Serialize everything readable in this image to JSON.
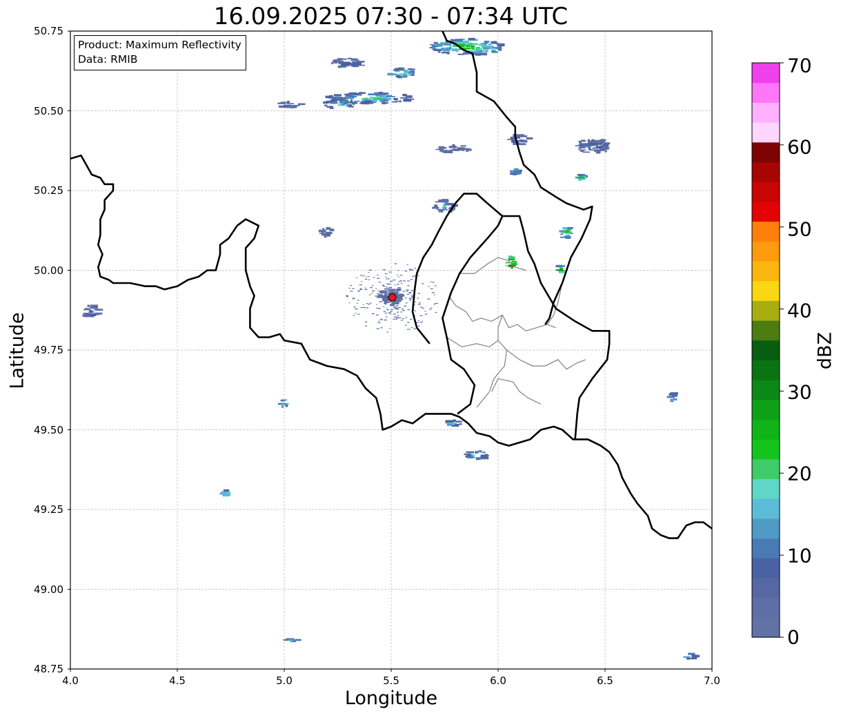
{
  "title": "16.09.2025 07:30 - 07:34 UTC",
  "info_box": {
    "product": "Product: Maximum Reflectivity",
    "data": "Data: RMIB"
  },
  "colorbar": {
    "label": "dBZ",
    "ticks": [
      "0",
      "10",
      "20",
      "30",
      "40",
      "50",
      "60",
      "70"
    ],
    "range": [
      0,
      70
    ],
    "colors": [
      "#6272a4",
      "#5e6ea6",
      "#5767a3",
      "#4a61a3",
      "#4a7ab4",
      "#509ac6",
      "#5cbcd8",
      "#5fd6c6",
      "#3ecc6a",
      "#13c41d",
      "#10b419",
      "#0ea117",
      "#0c8816",
      "#0a7312",
      "#095d10",
      "#4c7c12",
      "#a9ae10",
      "#fad713",
      "#fbb510",
      "#fd9a0e",
      "#fe800a",
      "#e30305",
      "#c80503",
      "#a70503",
      "#7d0402",
      "#ffd6ff",
      "#ffb1ff",
      "#ff77f9",
      "#f040ec"
    ]
  },
  "map": {
    "x_axis": {
      "label": "Longitude",
      "min": 4.0,
      "max": 7.0,
      "ticks": [
        "4.0",
        "4.5",
        "5.0",
        "5.5",
        "6.0",
        "6.5",
        "7.0"
      ]
    },
    "y_axis": {
      "label": "Latitude",
      "min": 48.75,
      "max": 50.75,
      "ticks": [
        "50.75",
        "50.50",
        "50.25",
        "50.00",
        "49.75",
        "49.50",
        "49.25",
        "49.00",
        "48.75"
      ]
    },
    "grid": true,
    "radar_site": {
      "lon": 5.505,
      "lat": 49.915,
      "color": "#e8141e"
    },
    "borders": {
      "west": [
        [
          4.0,
          50.35
        ],
        [
          4.05,
          50.36
        ],
        [
          4.1,
          50.3
        ],
        [
          4.14,
          50.29
        ],
        [
          4.16,
          50.27
        ],
        [
          4.2,
          50.27
        ],
        [
          4.2,
          50.25
        ],
        [
          4.16,
          50.22
        ],
        [
          4.16,
          50.19
        ],
        [
          4.14,
          50.16
        ],
        [
          4.14,
          50.11
        ],
        [
          4.13,
          50.08
        ],
        [
          4.15,
          50.05
        ],
        [
          4.14,
          50.03
        ],
        [
          4.13,
          50.01
        ],
        [
          4.14,
          49.98
        ],
        [
          4.18,
          49.97
        ],
        [
          4.2,
          49.96
        ],
        [
          4.28,
          49.96
        ],
        [
          4.35,
          49.95
        ],
        [
          4.4,
          49.95
        ],
        [
          4.44,
          49.94
        ],
        [
          4.5,
          49.95
        ],
        [
          4.55,
          49.97
        ],
        [
          4.6,
          49.98
        ],
        [
          4.64,
          50.0
        ],
        [
          4.68,
          50.0
        ],
        [
          4.7,
          50.05
        ],
        [
          4.7,
          50.08
        ],
        [
          4.74,
          50.1
        ],
        [
          4.78,
          50.14
        ],
        [
          4.82,
          50.16
        ],
        [
          4.85,
          50.15
        ],
        [
          4.88,
          50.14
        ],
        [
          4.86,
          50.1
        ],
        [
          4.82,
          50.07
        ],
        [
          4.82,
          50.0
        ],
        [
          4.84,
          49.95
        ],
        [
          4.86,
          49.92
        ],
        [
          4.84,
          49.88
        ],
        [
          4.84,
          49.82
        ],
        [
          4.88,
          49.79
        ],
        [
          4.93,
          49.79
        ],
        [
          4.98,
          49.8
        ],
        [
          5.0,
          49.78
        ],
        [
          5.08,
          49.77
        ],
        [
          5.12,
          49.72
        ],
        [
          5.2,
          49.7
        ],
        [
          5.28,
          49.69
        ],
        [
          5.34,
          49.67
        ],
        [
          5.38,
          49.63
        ],
        [
          5.43,
          49.6
        ],
        [
          5.45,
          49.55
        ],
        [
          5.46,
          49.5
        ],
        [
          5.5,
          49.51
        ],
        [
          5.55,
          49.53
        ],
        [
          5.6,
          49.52
        ],
        [
          5.66,
          49.55
        ],
        [
          5.72,
          49.55
        ],
        [
          5.78,
          49.55
        ],
        [
          5.82,
          49.54
        ],
        [
          5.86,
          49.52
        ],
        [
          5.9,
          49.49
        ],
        [
          5.96,
          49.48
        ],
        [
          6.0,
          49.46
        ],
        [
          6.05,
          49.45
        ],
        [
          6.1,
          49.46
        ],
        [
          6.15,
          49.47
        ],
        [
          6.2,
          49.5
        ],
        [
          6.26,
          49.51
        ],
        [
          6.3,
          49.5
        ],
        [
          6.35,
          49.47
        ],
        [
          6.42,
          49.47
        ],
        [
          6.48,
          49.45
        ],
        [
          6.52,
          49.43
        ],
        [
          6.56,
          49.39
        ],
        [
          6.58,
          49.35
        ],
        [
          6.62,
          49.3
        ],
        [
          6.65,
          49.27
        ],
        [
          6.7,
          49.23
        ],
        [
          6.72,
          49.19
        ],
        [
          6.76,
          49.17
        ],
        [
          6.8,
          49.16
        ],
        [
          6.84,
          49.16
        ],
        [
          6.86,
          49.18
        ],
        [
          6.88,
          49.2
        ],
        [
          6.92,
          49.21
        ],
        [
          6.96,
          49.21
        ],
        [
          7.0,
          49.19
        ]
      ],
      "luxembourg": [
        [
          5.81,
          49.55
        ],
        [
          5.87,
          49.58
        ],
        [
          5.89,
          49.64
        ],
        [
          5.84,
          49.69
        ],
        [
          5.78,
          49.72
        ],
        [
          5.76,
          49.79
        ],
        [
          5.74,
          49.85
        ],
        [
          5.78,
          49.93
        ],
        [
          5.82,
          49.99
        ],
        [
          5.87,
          50.04
        ],
        [
          5.95,
          50.1
        ],
        [
          6.0,
          50.14
        ],
        [
          6.02,
          50.17
        ],
        [
          6.1,
          50.17
        ],
        [
          6.12,
          50.12
        ],
        [
          6.14,
          50.06
        ],
        [
          6.17,
          50.02
        ],
        [
          6.2,
          49.96
        ],
        [
          6.27,
          49.88
        ],
        [
          6.36,
          49.84
        ],
        [
          6.44,
          49.81
        ],
        [
          6.52,
          49.81
        ],
        [
          6.52,
          49.77
        ],
        [
          6.51,
          49.72
        ],
        [
          6.44,
          49.66
        ],
        [
          6.38,
          49.6
        ],
        [
          6.37,
          49.55
        ],
        [
          6.36,
          49.47
        ]
      ],
      "north": [
        [
          5.74,
          50.75
        ],
        [
          5.76,
          50.72
        ],
        [
          5.8,
          50.71
        ],
        [
          5.84,
          50.69
        ],
        [
          5.88,
          50.68
        ],
        [
          5.9,
          50.62
        ],
        [
          5.9,
          50.56
        ],
        [
          5.98,
          50.53
        ],
        [
          6.04,
          50.48
        ],
        [
          6.08,
          50.45
        ],
        [
          6.08,
          50.42
        ],
        [
          6.1,
          50.37
        ],
        [
          6.12,
          50.33
        ],
        [
          6.17,
          50.3
        ],
        [
          6.2,
          50.26
        ],
        [
          6.27,
          50.23
        ],
        [
          6.32,
          50.21
        ],
        [
          6.4,
          50.19
        ],
        [
          6.44,
          50.2
        ],
        [
          6.43,
          50.16
        ],
        [
          6.39,
          50.1
        ],
        [
          6.34,
          50.04
        ],
        [
          6.3,
          49.96
        ],
        [
          6.26,
          49.9
        ],
        [
          6.24,
          49.85
        ],
        [
          6.22,
          49.83
        ]
      ],
      "east_inner": [
        [
          6.02,
          50.17
        ],
        [
          5.95,
          50.21
        ],
        [
          5.9,
          50.24
        ],
        [
          5.84,
          50.24
        ],
        [
          5.8,
          50.21
        ],
        [
          5.76,
          50.17
        ],
        [
          5.72,
          50.12
        ],
        [
          5.69,
          50.08
        ],
        [
          5.65,
          50.04
        ],
        [
          5.62,
          49.99
        ],
        [
          5.61,
          49.94
        ],
        [
          5.6,
          49.87
        ],
        [
          5.62,
          49.82
        ],
        [
          5.68,
          49.77
        ]
      ]
    },
    "regions": [
      [
        [
          5.82,
          49.99
        ],
        [
          5.89,
          49.99
        ],
        [
          5.95,
          50.02
        ],
        [
          6.0,
          50.04
        ],
        [
          6.05,
          50.03
        ],
        [
          6.08,
          50.01
        ],
        [
          6.13,
          50.0
        ]
      ],
      [
        [
          5.77,
          49.92
        ],
        [
          5.8,
          49.89
        ],
        [
          5.85,
          49.87
        ],
        [
          5.88,
          49.84
        ],
        [
          5.92,
          49.85
        ],
        [
          5.97,
          49.84
        ],
        [
          6.02,
          49.86
        ]
      ],
      [
        [
          6.02,
          49.86
        ],
        [
          6.05,
          49.82
        ],
        [
          6.09,
          49.83
        ],
        [
          6.13,
          49.81
        ],
        [
          6.18,
          49.82
        ],
        [
          6.23,
          49.83
        ],
        [
          6.27,
          49.82
        ]
      ],
      [
        [
          6.02,
          49.86
        ],
        [
          6.0,
          49.82
        ],
        [
          6.0,
          49.78
        ],
        [
          6.04,
          49.75
        ],
        [
          6.03,
          49.7
        ],
        [
          5.98,
          49.66
        ],
        [
          5.96,
          49.62
        ],
        [
          5.9,
          49.57
        ]
      ],
      [
        [
          6.04,
          49.75
        ],
        [
          6.1,
          49.72
        ],
        [
          6.16,
          49.7
        ],
        [
          6.22,
          49.7
        ],
        [
          6.28,
          49.72
        ],
        [
          6.32,
          49.69
        ],
        [
          6.37,
          49.71
        ],
        [
          6.41,
          49.72
        ]
      ],
      [
        [
          6.2,
          49.58
        ],
        [
          6.14,
          49.6
        ],
        [
          6.1,
          49.62
        ],
        [
          6.07,
          49.65
        ],
        [
          6.0,
          49.66
        ],
        [
          5.97,
          49.62
        ]
      ],
      [
        [
          6.23,
          49.83
        ],
        [
          6.26,
          49.86
        ],
        [
          6.28,
          49.9
        ],
        [
          6.3,
          49.96
        ]
      ],
      [
        [
          5.76,
          49.79
        ],
        [
          5.83,
          49.76
        ],
        [
          5.9,
          49.77
        ],
        [
          5.96,
          49.76
        ],
        [
          6.0,
          49.78
        ]
      ]
    ]
  },
  "chart_data": {
    "type": "heatmap",
    "title": "16.09.2025 07:30 - 07:34 UTC",
    "xlabel": "Longitude",
    "ylabel": "Latitude",
    "xlim": [
      4.0,
      7.0
    ],
    "ylim": [
      48.75,
      50.75
    ],
    "colorbar_label": "dBZ",
    "colorbar_range": [
      0,
      70
    ],
    "colorbar_ticks": [
      0,
      10,
      20,
      30,
      40,
      50,
      60,
      70
    ],
    "echo_cells": [
      {
        "lon": 5.85,
        "lat": 50.7,
        "dlon": 0.35,
        "dlat": 0.05,
        "dbz": 25
      },
      {
        "lon": 5.55,
        "lat": 50.62,
        "dlon": 0.15,
        "dlat": 0.03,
        "dbz": 22
      },
      {
        "lon": 5.3,
        "lat": 50.65,
        "dlon": 0.15,
        "dlat": 0.03,
        "dbz": 10
      },
      {
        "lon": 5.4,
        "lat": 50.54,
        "dlon": 0.4,
        "dlat": 0.035,
        "dbz": 20
      },
      {
        "lon": 5.03,
        "lat": 50.52,
        "dlon": 0.12,
        "dlat": 0.02,
        "dbz": 10
      },
      {
        "lon": 5.25,
        "lat": 50.52,
        "dlon": 0.15,
        "dlat": 0.03,
        "dbz": 18
      },
      {
        "lon": 5.8,
        "lat": 50.38,
        "dlon": 0.15,
        "dlat": 0.025,
        "dbz": 8
      },
      {
        "lon": 6.1,
        "lat": 50.41,
        "dlon": 0.1,
        "dlat": 0.03,
        "dbz": 10
      },
      {
        "lon": 6.08,
        "lat": 50.31,
        "dlon": 0.03,
        "dlat": 0.02,
        "dbz": 20
      },
      {
        "lon": 6.45,
        "lat": 50.39,
        "dlon": 0.15,
        "dlat": 0.05,
        "dbz": 10
      },
      {
        "lon": 6.39,
        "lat": 50.29,
        "dlon": 0.04,
        "dlat": 0.02,
        "dbz": 25
      },
      {
        "lon": 5.2,
        "lat": 50.12,
        "dlon": 0.05,
        "dlat": 0.03,
        "dbz": 8
      },
      {
        "lon": 5.75,
        "lat": 50.2,
        "dlon": 0.1,
        "dlat": 0.04,
        "dbz": 15
      },
      {
        "lon": 6.32,
        "lat": 50.12,
        "dlon": 0.05,
        "dlat": 0.04,
        "dbz": 25
      },
      {
        "lon": 6.06,
        "lat": 50.02,
        "dlon": 0.04,
        "dlat": 0.05,
        "dbz": 45
      },
      {
        "lon": 6.29,
        "lat": 50.0,
        "dlon": 0.03,
        "dlat": 0.03,
        "dbz": 35
      },
      {
        "lon": 4.1,
        "lat": 49.87,
        "dlon": 0.08,
        "dlat": 0.04,
        "dbz": 8
      },
      {
        "lon": 5.5,
        "lat": 49.92,
        "dlon": 0.1,
        "dlat": 0.06,
        "dbz": 5
      },
      {
        "lon": 5.0,
        "lat": 49.58,
        "dlon": 0.03,
        "dlat": 0.03,
        "dbz": 22
      },
      {
        "lon": 5.9,
        "lat": 49.42,
        "dlon": 0.1,
        "dlat": 0.03,
        "dbz": 22
      },
      {
        "lon": 5.78,
        "lat": 49.52,
        "dlon": 0.1,
        "dlat": 0.02,
        "dbz": 20
      },
      {
        "lon": 6.82,
        "lat": 49.6,
        "dlon": 0.03,
        "dlat": 0.03,
        "dbz": 20
      },
      {
        "lon": 4.73,
        "lat": 49.3,
        "dlon": 0.03,
        "dlat": 0.02,
        "dbz": 22
      },
      {
        "lon": 6.9,
        "lat": 48.79,
        "dlon": 0.05,
        "dlat": 0.02,
        "dbz": 20
      },
      {
        "lon": 5.04,
        "lat": 48.84,
        "dlon": 0.06,
        "dlat": 0.01,
        "dbz": 20
      }
    ]
  }
}
